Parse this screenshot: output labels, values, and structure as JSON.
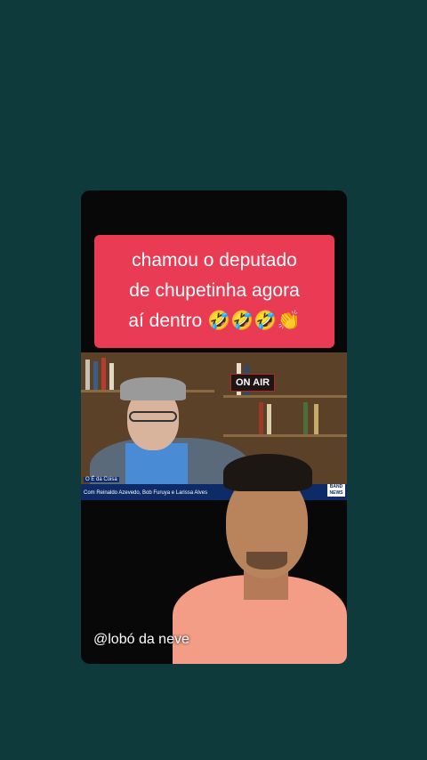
{
  "caption": {
    "line1": "chamou o deputado",
    "line2": "de chupetinha agora",
    "line3": "aí dentro 🤣🤣🤣👏"
  },
  "studio": {
    "on_air": "ON AIR",
    "show_title": "O É da Coisa",
    "show_subtitle": "Com Reinaldo Azevedo, Bob Furuya e Larissa Alves",
    "logo_text": "BAND NEWS"
  },
  "watermark": "@lobó da neve",
  "colors": {
    "background": "#0e3a3b",
    "caption_bg": "#ea3b55",
    "shirt": "#f49d86"
  }
}
